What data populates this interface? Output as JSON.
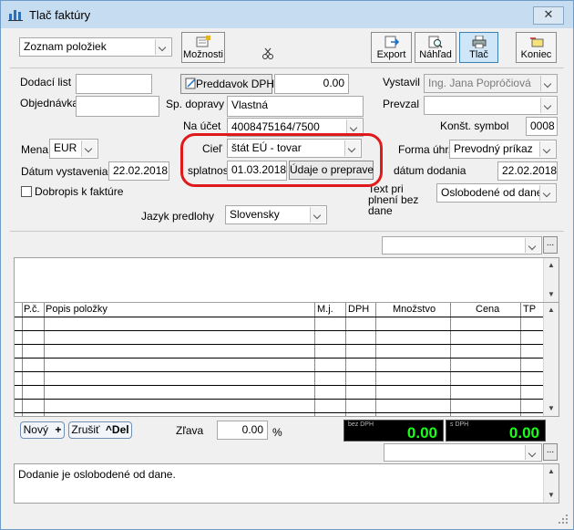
{
  "window": {
    "title": "Tlač faktúry"
  },
  "toolbar": {
    "list_select": "Zoznam položiek",
    "options_label": "Možnosti",
    "export_label": "Export",
    "preview_label": "Náhľad",
    "print_label": "Tlač",
    "exit_label": "Koniec"
  },
  "form": {
    "dodaci_list_label": "Dodací list",
    "dodaci_list_value": "",
    "objednavka_label": "Objednávka",
    "objednavka_value": "",
    "preddavok_button": "Preddavok DPH",
    "preddavok_value": "0.00",
    "sp_dopravy_label": "Sp. dopravy",
    "sp_dopravy_value": "Vlastná",
    "na_ucet_label": "Na účet",
    "na_ucet_value": "4008475164/7500",
    "vystavil_label": "Vystavil",
    "vystavil_value": "Ing. Jana Popróčiová",
    "prevzal_label": "Prevzal",
    "prevzal_value": "",
    "konst_symbol_label": "Konšt. symbol",
    "konst_symbol_value": "0008",
    "mena_label": "Mena",
    "mena_value": "EUR",
    "ciel_label": "Cieľ",
    "ciel_value": "štát EÚ - tovar",
    "forma_uhr_label": "Forma úhr.",
    "forma_uhr_value": "Prevodný príkaz",
    "datum_vystavenia_label": "Dátum vystavenia",
    "datum_vystavenia_value": "22.02.2018",
    "splatnosti_label": "splatnosti",
    "splatnosti_value": "01.03.2018",
    "udaje_button": "Údaje o preprave",
    "datum_dodania_label": "dátum dodania",
    "datum_dodania_value": "22.02.2018",
    "dobropis_label": "Dobropis k faktúre",
    "text_plneni_label": "Text pri plnení bez dane",
    "text_plneni_value": "Oslobodené od dane",
    "jazyk_label": "Jazyk predlohy",
    "jazyk_value": "Slovensky"
  },
  "grid": {
    "columns": [
      "P.č.",
      "Popis položky",
      "M.j.",
      "DPH",
      "Množstvo",
      "Cena",
      "TP"
    ]
  },
  "footer": {
    "new_button": "Nový",
    "new_shortcut": "+",
    "cancel_button": "Zrušiť",
    "cancel_shortcut": "^Del",
    "zlava_label": "Zľava",
    "zlava_value": "0.00",
    "percent_sign": "%",
    "bez_dph_caption": "bez DPH",
    "bez_dph_value": "0.00",
    "s_dph_caption": "s DPH",
    "s_dph_value": "0.00",
    "note_text": "Dodanie je oslobodené od dane."
  },
  "colors": {
    "highlight": "#e01a1a",
    "totals_text": "#19ff19",
    "title_bar": "#c6dcf1"
  }
}
